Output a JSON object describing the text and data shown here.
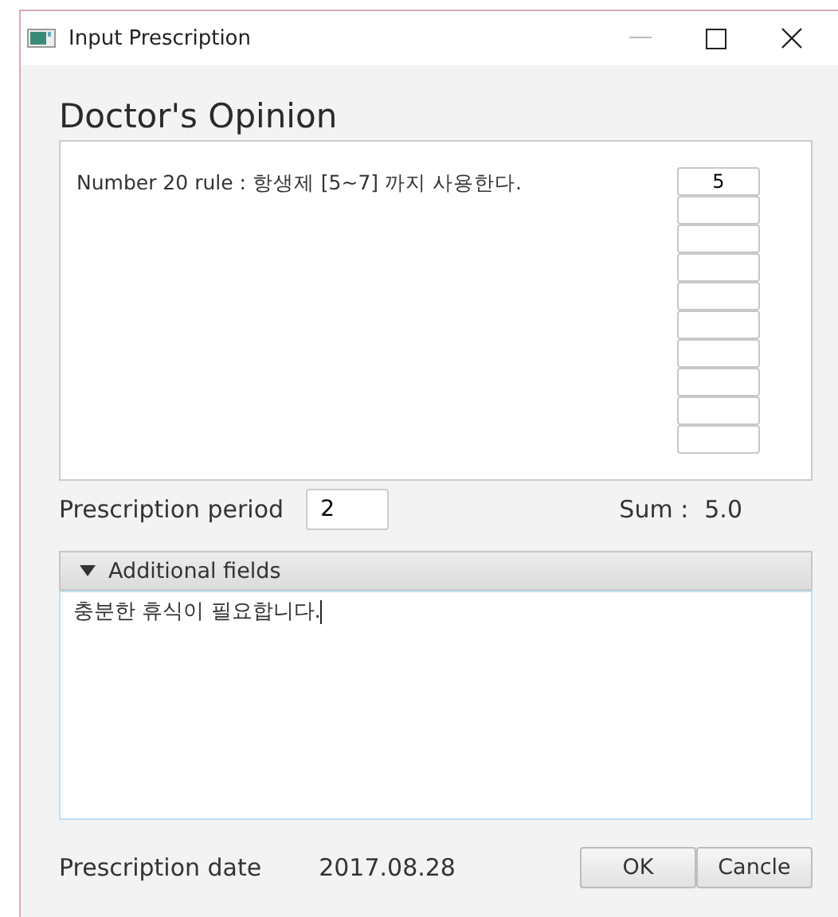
{
  "window": {
    "title": "Input Prescription"
  },
  "heading": "Doctor's Opinion",
  "opinion": {
    "rule": "Number 20 rule : 항생제 [5~7] 까지 사용한다.",
    "score_fields": [
      {
        "kind": "filled",
        "value": "5"
      },
      {
        "kind": "blank"
      },
      {
        "kind": "blank"
      },
      {
        "kind": "blank"
      },
      {
        "kind": "blank"
      },
      {
        "kind": "blank"
      },
      {
        "kind": "blank"
      },
      {
        "kind": "blank"
      },
      {
        "kind": "blank"
      },
      {
        "kind": "blank"
      }
    ]
  },
  "period": {
    "label": "Prescription period",
    "value": "2"
  },
  "sum": {
    "label": "Sum :",
    "value": "5.0"
  },
  "additional": {
    "label": "Additional fields",
    "expanded": true,
    "value": "충분한 휴식이 필요합니다."
  },
  "date": {
    "label": "Prescription date",
    "value": "2017.08.28"
  },
  "buttons": [
    "OK",
    "Cancle"
  ]
}
